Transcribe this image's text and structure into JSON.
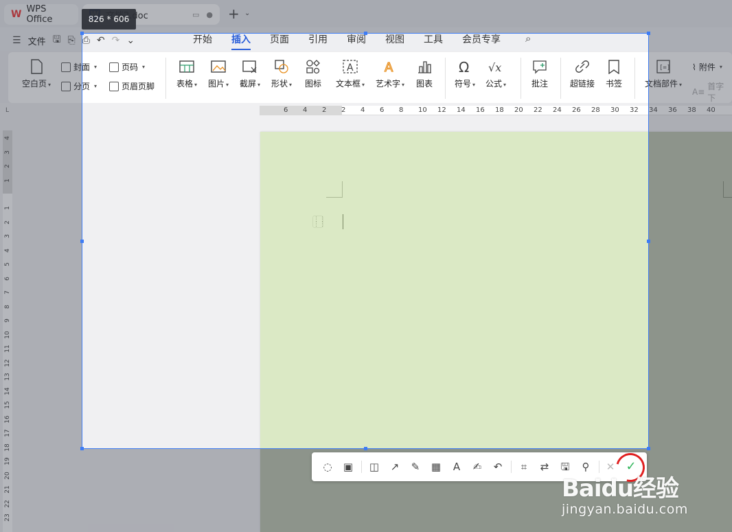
{
  "tabs": {
    "wps_label": "WPS Office",
    "doc_label": "文档2.doc"
  },
  "size_badge": "826 * 606",
  "menu": {
    "file_label": "文件",
    "tabs": [
      "开始",
      "插入",
      "页面",
      "引用",
      "审阅",
      "视图",
      "工具",
      "会员专享"
    ],
    "active_tab": "插入"
  },
  "ribbon": {
    "blank_page": "空白页",
    "cover": "封面",
    "page_break": "分页",
    "page_number": "页码",
    "header_footer": "页眉页脚",
    "table": "表格",
    "picture": "图片",
    "screenshot": "截屏",
    "shape": "形状",
    "icon": "图标",
    "text_box": "文本框",
    "word_art": "艺术字",
    "chart": "图表",
    "symbol": "符号",
    "formula": "公式",
    "comment": "批注",
    "hyperlink": "超链接",
    "bookmark": "书签",
    "doc_parts": "文档部件",
    "attachment": "附件",
    "drop_cap": "首字下"
  },
  "ruler": {
    "h_ticks": [
      "6",
      "4",
      "2",
      "2",
      "4",
      "6",
      "8",
      "10",
      "12",
      "14",
      "16",
      "18",
      "20",
      "22",
      "24",
      "26",
      "28",
      "30",
      "32",
      "34",
      "36",
      "38",
      "40"
    ],
    "v_ticks": [
      "4",
      "3",
      "2",
      "1",
      "1",
      "2",
      "3",
      "4",
      "5",
      "6",
      "7",
      "8",
      "9",
      "10",
      "11",
      "12",
      "13",
      "14",
      "15",
      "16",
      "17",
      "18",
      "19",
      "20",
      "21",
      "22",
      "23"
    ]
  },
  "capture_tools": [
    "lasso-select",
    "record-video",
    "shape",
    "arrow",
    "pen",
    "mosaic",
    "text",
    "sign",
    "undo",
    "ocr",
    "translate",
    "save",
    "pin",
    "close",
    "confirm"
  ],
  "watermark": {
    "logo": "Baidu经验",
    "url": "jingyan.baidu.com"
  },
  "colors": {
    "accent": "#2b5fd9",
    "selection": "#3d7cf5",
    "confirm": "#2fb55a",
    "ring": "#e02020"
  }
}
